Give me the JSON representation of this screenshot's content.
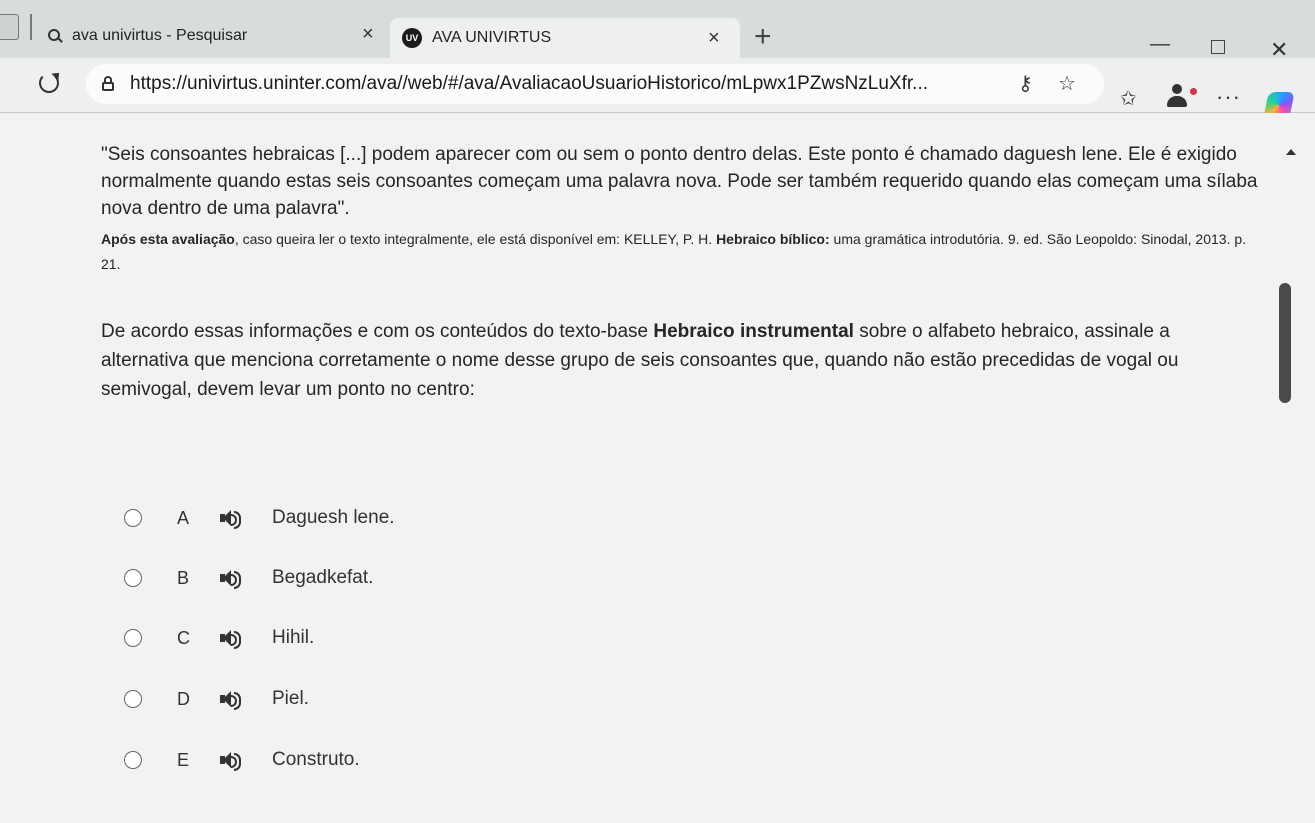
{
  "browser": {
    "tabs": [
      {
        "title": "ava univirtus - Pesquisar",
        "icon": "search-icon",
        "active": false
      },
      {
        "title": "AVA UNIVIRTUS",
        "icon": "univirtus-favicon-icon",
        "favicon_text": "UV",
        "active": true
      }
    ],
    "close_glyph": "×",
    "new_tab_glyph": "+",
    "minimize_glyph": "—",
    "close_window_glyph": "✕",
    "url": "https://univirtus.uninter.com/ava//web/#/ava/AvaliacaoUsuarioHistorico/mLpwx1PZwsNzLuXfr...",
    "key_glyph": "⚷",
    "star_glyph": "☆",
    "favorites_glyph": "✩",
    "more_glyph": "···"
  },
  "page": {
    "quote": "\"Seis consoantes hebraicas [...] podem aparecer com ou sem o ponto dentro delas. Este ponto é chamado daguesh lene. Ele é exigido normalmente quando estas seis consoantes começam uma palavra nova. Pode ser também requerido quando elas começam uma sílaba nova dentro de uma palavra\".",
    "reference": {
      "bold_intro": "Após esta avaliação",
      "middle": ", caso queira ler o texto integralmente, ele está disponível em: KELLEY, P. H. ",
      "bold_title": "Hebraico bíblico:",
      "tail": " uma gramática introdutória. 9. ed. São Leopoldo: Sinodal, 2013. p. 21."
    },
    "question": {
      "before": "De acordo essas informações e com os conteúdos do texto-base ",
      "bold": "Hebraico instrumental",
      "after": " sobre o alfabeto hebraico, assinale a alternativa que menciona corretamente o nome desse grupo de seis consoantes que, quando não estão precedidas de vogal ou semivogal, devem levar um ponto no centro:"
    },
    "options": [
      {
        "letter": "A",
        "text": "Daguesh lene."
      },
      {
        "letter": "B",
        "text": "Begadkefat."
      },
      {
        "letter": "C",
        "text": "Hihil."
      },
      {
        "letter": "D",
        "text": "Piel."
      },
      {
        "letter": "E",
        "text": "Construto."
      }
    ]
  }
}
